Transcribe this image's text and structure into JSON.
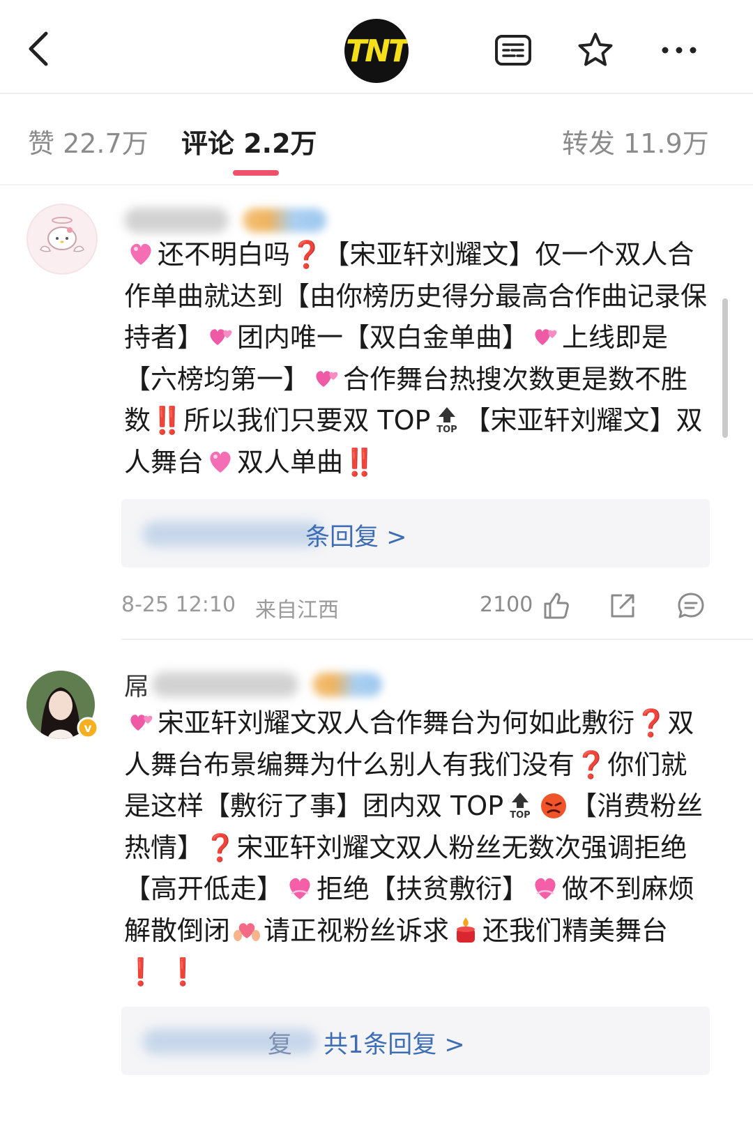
{
  "header": {
    "logo_text": "TNT"
  },
  "tabs": {
    "likes": "赞 22.7万",
    "comments": "评论 2.2万",
    "reposts": "转发 11.9万",
    "active": "comments"
  },
  "comments": [
    {
      "text_parts": [
        "还不明白吗",
        "【宋亚轩刘耀文】仅一个双人合作单曲就达到【由你榜历史得分最高合作曲记录保持者】",
        "团内唯一【双白金单曲】",
        "上线即是【六榜均第一】",
        "合作舞台热搜次数更是数不胜数",
        "所以我们只要双 TOP",
        "【宋亚轩刘耀文】双人舞台",
        "双人单曲"
      ],
      "reply_link": "条回复 >",
      "time": "8-25 12:10",
      "location": "来自江西",
      "likes": "2100"
    },
    {
      "name_initial": "屌",
      "text_parts": [
        "宋亚轩刘耀文双人合作舞台为何如此敷衍",
        "双人舞台布景编舞为什么别人有我们没有",
        "你们就是这样【敷衍了事】团内双 TOP",
        "【消费粉丝热情】",
        "宋亚轩刘耀文双人粉丝无数次强调拒绝【高开低走】",
        "拒绝【扶贫敷衍】",
        "做不到麻烦解散倒闭",
        "请正视粉丝诉求",
        "还我们精美舞台"
      ],
      "reply_link_prefix": "复",
      "reply_link": "共1条回复 >"
    }
  ],
  "colors": {
    "accent": "#f0516a",
    "link": "#3d6db5",
    "meta": "#9a9a9a"
  }
}
